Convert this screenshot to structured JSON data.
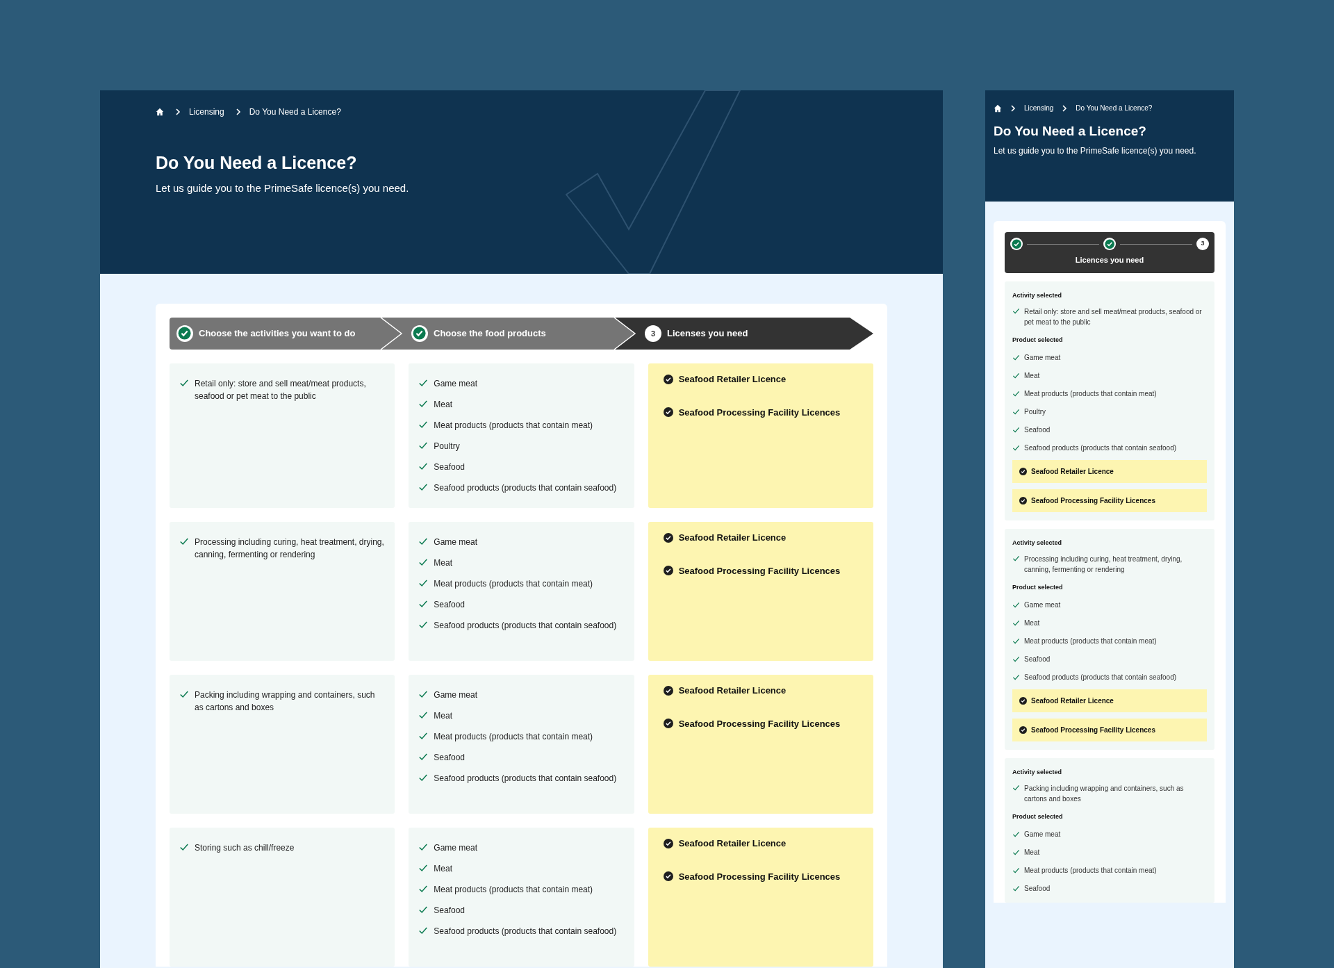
{
  "desktop": {
    "breadcrumbs": [
      "Licensing",
      "Do You Need a Licence?"
    ],
    "title": "Do You Need a Licence?",
    "subtitle": "Let us guide you to the PrimeSafe licence(s) you need.",
    "steps": [
      {
        "label": "Choose the activities you want to do",
        "completed": true
      },
      {
        "label": "Choose the food products",
        "completed": true
      },
      {
        "label": "Licenses you need",
        "completed": false,
        "number": "3"
      }
    ],
    "rows": [
      {
        "activity": "Retail only: store and sell meat/meat products, seafood or pet meat to the public",
        "products": [
          "Game meat",
          "Meat",
          "Meat products (products that contain meat)",
          "Poultry",
          "Seafood",
          "Seafood products (products that contain seafood)"
        ],
        "licences": [
          "Seafood Retailer Licence",
          "Seafood Processing Facility Licences"
        ]
      },
      {
        "activity": "Processing including curing, heat treatment, drying, canning, fermenting or rendering",
        "products": [
          "Game meat",
          "Meat",
          "Meat products (products that contain meat)",
          "Seafood",
          "Seafood products (products that contain seafood)"
        ],
        "licences": [
          "Seafood Retailer Licence",
          "Seafood Processing Facility Licences"
        ]
      },
      {
        "activity": "Packing including wrapping and containers, such as cartons and boxes",
        "products": [
          "Game meat",
          "Meat",
          "Meat products (products that contain meat)",
          "Seafood",
          "Seafood products (products that contain seafood)"
        ],
        "licences": [
          "Seafood Retailer Licence",
          "Seafood Processing Facility Licences"
        ]
      },
      {
        "activity": "Storing such as chill/freeze",
        "products": [
          "Game meat",
          "Meat",
          "Meat products (products that contain meat)",
          "Seafood",
          "Seafood products (products that contain seafood)"
        ],
        "licences": [
          "Seafood Retailer Licence",
          "Seafood Processing Facility Licences"
        ]
      }
    ]
  },
  "mobile": {
    "breadcrumbs": [
      "Licensing",
      "Do You Need a Licence?"
    ],
    "title": "Do You Need a Licence?",
    "subtitle": "Let us guide you to the PrimeSafe licence(s) you need.",
    "steps": [
      {
        "completed": true
      },
      {
        "completed": true
      },
      {
        "completed": false,
        "number": "3"
      }
    ],
    "current_step_label": "Licences you need",
    "sections": [
      {
        "activity_heading": "Activity selected",
        "activity": "Retail only: store and sell meat/meat products, seafood or pet meat to the public",
        "product_heading": "Product selected",
        "products": [
          "Game meat",
          "Meat",
          "Meat products (products that contain meat)",
          "Poultry",
          "Seafood",
          "Seafood products (products that contain seafood)"
        ],
        "licences": [
          "Seafood Retailer Licence",
          "Seafood Processing Facility Licences"
        ]
      },
      {
        "activity_heading": "Activity selected",
        "activity": "Processing including curing, heat treatment, drying, canning, fermenting or rendering",
        "product_heading": "Product selected",
        "products": [
          "Game meat",
          "Meat",
          "Meat products (products that contain meat)",
          "Seafood",
          "Seafood products (products that contain seafood)"
        ],
        "licences": [
          "Seafood Retailer Licence",
          "Seafood Processing Facility Licences"
        ]
      },
      {
        "activity_heading": "Activity selected",
        "activity": "Packing including wrapping and containers, such as cartons and boxes",
        "product_heading": "Product selected",
        "products": [
          "Game meat",
          "Meat",
          "Meat products (products that contain meat)",
          "Seafood"
        ]
      }
    ]
  }
}
